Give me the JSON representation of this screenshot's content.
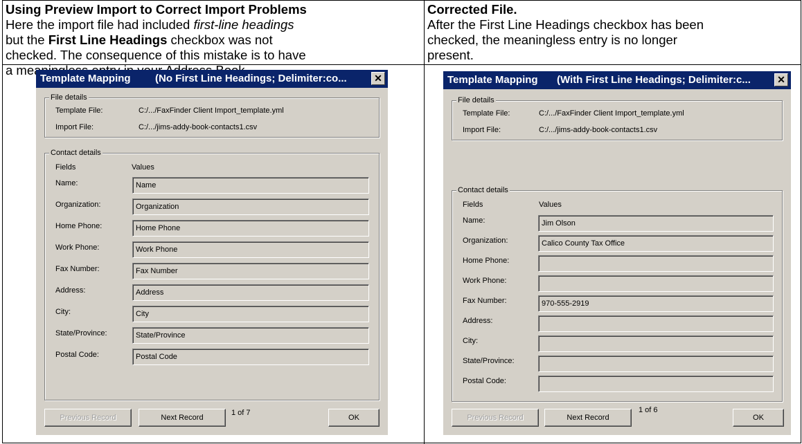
{
  "left_cell": {
    "title": "Using Preview Import to Correct Import Problems",
    "p1": "Here the import file had  included ",
    "p1_italic": "first-line headings",
    "p2": "but the ",
    "p2_bold": "First Line Headings",
    "p2_end": " checkbox was not",
    "p3": "checked.  The consequence of this mistake is to have",
    "p4": "a meaningless entry in your Address Book."
  },
  "right_cell": {
    "title": "Corrected File.",
    "p1": "After the First Line Headings checkbox has been",
    "p2": "checked, the meaningless entry is no longer",
    "p3": "present."
  },
  "dialog_left": {
    "title": "Template Mapping",
    "subtitle": "(No First Line Headings; Delimiter:co...",
    "close": "✕",
    "file_group": "File details",
    "template_label": "Template File:",
    "template_value": "C:/.../FaxFinder Client Import_template.yml",
    "import_label": "Import File:",
    "import_value": "C:/.../jims-addy-book-contacts1.csv",
    "contact_group": "Contact details",
    "fields_header": "Fields",
    "values_header": "Values",
    "rows": [
      {
        "label": "Name:",
        "value": "Name"
      },
      {
        "label": "Organization:",
        "value": "Organization"
      },
      {
        "label": "Home Phone:",
        "value": "Home Phone"
      },
      {
        "label": "Work Phone:",
        "value": "Work Phone"
      },
      {
        "label": "Fax Number:",
        "value": "Fax Number"
      },
      {
        "label": "Address:",
        "value": "Address"
      },
      {
        "label": "City:",
        "value": "City"
      },
      {
        "label": "State/Province:",
        "value": "State/Province"
      },
      {
        "label": "Postal Code:",
        "value": "Postal Code"
      }
    ],
    "prev_btn": "Previous Record",
    "next_btn": "Next Record",
    "count": "1 of 7",
    "ok_btn": "OK"
  },
  "dialog_right": {
    "title": "Template Mapping",
    "subtitle": "(With First Line Headings; Delimiter:c...",
    "close": "✕",
    "file_group": "File details",
    "template_label": "Template File:",
    "template_value": "C:/.../FaxFinder Client Import_template.yml",
    "import_label": "Import File:",
    "import_value": "C:/.../jims-addy-book-contacts1.csv",
    "contact_group": "Contact details",
    "fields_header": "Fields",
    "values_header": "Values",
    "rows": [
      {
        "label": "Name:",
        "value": "Jim Olson"
      },
      {
        "label": "Organization:",
        "value": "Calico County Tax Office"
      },
      {
        "label": "Home Phone:",
        "value": ""
      },
      {
        "label": "Work Phone:",
        "value": ""
      },
      {
        "label": "Fax Number:",
        "value": "970-555-2919"
      },
      {
        "label": "Address:",
        "value": ""
      },
      {
        "label": "City:",
        "value": ""
      },
      {
        "label": "State/Province:",
        "value": ""
      },
      {
        "label": "Postal Code:",
        "value": ""
      }
    ],
    "prev_btn": "Previous Record",
    "next_btn": "Next Record",
    "count": "1 of 6",
    "ok_btn": "OK"
  }
}
